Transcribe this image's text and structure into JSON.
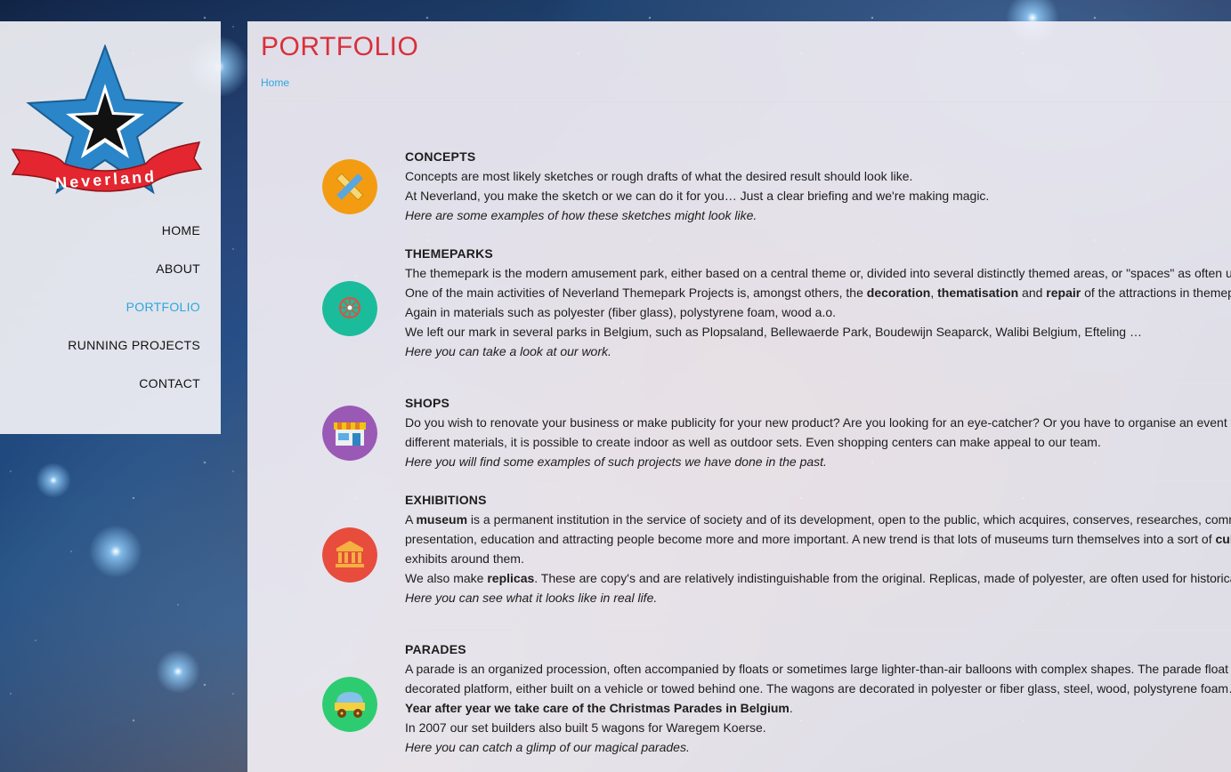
{
  "logo": {
    "text": "Neverland"
  },
  "nav": [
    {
      "label": "HOME",
      "active": false
    },
    {
      "label": "ABOUT",
      "active": false
    },
    {
      "label": "PORTFOLIO",
      "active": true
    },
    {
      "label": "RUNNING PROJECTS",
      "active": false
    },
    {
      "label": "CONTACT",
      "active": false
    }
  ],
  "page": {
    "title": "PORTFOLIO",
    "breadcrumb": "Home"
  },
  "colors": {
    "accent_red": "#d9303b",
    "accent_blue": "#2ba6df",
    "concepts_icon": "#f39c12",
    "themeparks_icon": "#1abc9c",
    "shops_icon": "#9b59b6",
    "exhibitions_icon": "#e74c3c",
    "parades_icon": "#2ecc71"
  },
  "sections": {
    "concepts": {
      "icon": "pencil-ruler-icon",
      "title": "CONCEPTS",
      "line1": "Concepts are most likely sketches or rough drafts of what the desired result should look like.",
      "line2": "At Neverland, you make the sketch or we can do it for you… Just a clear briefing and we're making magic.",
      "link": "Here are some examples of how these sketches might look like."
    },
    "themeparks": {
      "icon": "ferris-wheel-icon",
      "title": "THEMEPARKS",
      "line1": "The themepark is the modern amusement park, either based on a central theme or, divided into several distinctly themed areas, or \"spaces\" as often used",
      "line2_a": "One of the main activities of Neverland Themepark Projects is, amongst others, the ",
      "line2_b1": "decoration",
      "line2_c": ", ",
      "line2_b2": "thematisation",
      "line2_d": " and ",
      "line2_b3": "repair",
      "line2_e": " of the attractions in themepar",
      "line3": "Again in materials such as polyester (fiber glass), polystyrene foam, wood a.o.",
      "line4": "We left our mark in several parks in Belgium, such as Plopsaland, Bellewaerde Park, Boudewijn Seaparck, Walibi Belgium, Efteling …",
      "link": "Here you can take a look at our work."
    },
    "shops": {
      "icon": "shop-icon",
      "title": "SHOPS",
      "line1": "Do you wish to renovate your business or make publicity for your new product? Are you looking for an eye-catcher? Or you have to organise an event that",
      "line2": "different materials, it is possible to create indoor as well as outdoor sets. Even shopping centers can make appeal to our team.",
      "link": "Here you will find some examples of such projects we have done in the past."
    },
    "exhibitions": {
      "icon": "museum-icon",
      "title": "EXHIBITIONS",
      "line1_a": "A ",
      "line1_b": "museum",
      "line1_c": " is a permanent institution in the service of society and of its development, open to the public, which acquires, conserves, researches, commun",
      "line2_a": "presentation, education and attracting people become more and more important. A new trend is that lots of museums turn themselves into a sort of ",
      "line2_b": "cult",
      "line3": "exhibits around them.",
      "line4_a": "We also make ",
      "line4_b": "replicas",
      "line4_c": ". These are copy's and are relatively indistinguishable from the original. Replicas, made of polyester, are often used for historical pu",
      "link": "Here you can see what it looks like in real life."
    },
    "parades": {
      "icon": "wagon-icon",
      "title": "PARADES",
      "line1": "A parade is an organized procession, often accompanied by floats or sometimes large lighter-than-air balloons with complex shapes. The parade float got",
      "line2": "decorated platform, either built on a vehicle or towed behind one. The wagons are decorated in polyester or fiber glass, steel, wood, polystyrene foam…",
      "line3_b": "Year after year we take care of the Christmas Parades in Belgium",
      "line3_c": ".",
      "line4": "In 2007 our set builders also built 5 wagons for Waregem Koerse.",
      "link": "Here you can catch a glimp of our magical parades."
    }
  }
}
